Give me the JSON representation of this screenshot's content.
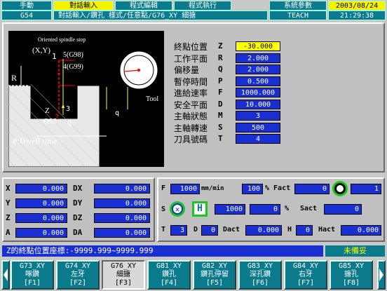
{
  "top_tabs": [
    {
      "label": "手動",
      "selected": false
    },
    {
      "label": "對話輸入",
      "selected": true
    },
    {
      "label": "程式編輯",
      "selected": false
    },
    {
      "label": "程式執行",
      "selected": false
    },
    {
      "label": "系統參數",
      "selected": false
    },
    {
      "label": "2003/08/24",
      "selected": true
    }
  ],
  "info_bar": {
    "gcode": "G54",
    "breadcrumb": "對話輸入/鑽孔 樣式/任意點/G76_XY 細搪",
    "mode": "TEACH",
    "time": "21:29:38"
  },
  "diagram": {
    "labels": [
      "Oriented spindle stop",
      "(X,Y)",
      "1",
      "5(G98)",
      "4(G99)",
      "R",
      "Z",
      "3",
      "2",
      "OSS",
      "q",
      "P:Dwell time",
      "Tool",
      "q"
    ]
  },
  "params": [
    {
      "label": "終點位置",
      "letter": "Z",
      "value": "-30.000",
      "active": true
    },
    {
      "label": "工作平面",
      "letter": "R",
      "value": "2.000",
      "active": false
    },
    {
      "label": "偏移量",
      "letter": "Q",
      "value": "2.000",
      "active": false
    },
    {
      "label": "暫停時間",
      "letter": "P",
      "value": "0.500",
      "active": false
    },
    {
      "label": "進給速率",
      "letter": "F",
      "value": "1000.000",
      "active": false
    },
    {
      "label": "安全平面",
      "letter": "D",
      "value": "10.000",
      "active": false
    },
    {
      "label": "主軸狀態",
      "letter": "M",
      "value": "3",
      "active": false
    },
    {
      "label": "主軸轉速",
      "letter": "S",
      "value": "500",
      "active": false
    },
    {
      "label": "刀具號碼",
      "letter": "T",
      "value": "4",
      "active": false
    }
  ],
  "axes": [
    {
      "a": "X",
      "av": "0.000",
      "b": "DX",
      "bv": "0.000"
    },
    {
      "a": "Y",
      "av": "0.000",
      "b": "DY",
      "bv": "0.000"
    },
    {
      "a": "Z",
      "av": "0.000",
      "b": "DZ",
      "bv": "0.000"
    },
    {
      "a": "A",
      "av": "0.000",
      "b": "DA",
      "bv": "0.000"
    }
  ],
  "feed": {
    "f_letter": "F",
    "f_value": "1000",
    "f_unit": "mm/min",
    "f_pct": "100",
    "fact_label": "% Fact",
    "fact_value": "0",
    "spindle_idx": "1",
    "s_letter": "S",
    "h_label": "H",
    "s_value": "1000",
    "s_pct": "0",
    "s_pct_sign": "%",
    "sact_label": "Sact",
    "sact_value": "0",
    "t_letter": "T",
    "t_value": "3",
    "d_letter": "D",
    "d_value": "0",
    "dact_label": "Dact",
    "dact_value": "0.000",
    "h_letter": "H",
    "h_value": "0",
    "hact_label": "Hact",
    "hact_value": "0.000"
  },
  "status": {
    "message": "Z的終點位置座標:-9999.999~9999.999",
    "state": "未備妥"
  },
  "softkeys": [
    {
      "l1": "G73_XY",
      "l2": "啄鑽",
      "l3": "[F1]",
      "selected": false
    },
    {
      "l1": "G74_XY",
      "l2": "左牙",
      "l3": "[F2]",
      "selected": false
    },
    {
      "l1": "G76_XY",
      "l2": "細搪",
      "l3": "[F3]",
      "selected": true
    },
    {
      "l1": "G81_XY",
      "l2": "鑽孔",
      "l3": "[F4]",
      "selected": false
    },
    {
      "l1": "G82_XY",
      "l2": "鑽孔停留",
      "l3": "[F5]",
      "selected": false
    },
    {
      "l1": "G83_XY",
      "l2": "深孔鑽",
      "l3": "[F6]",
      "selected": false
    },
    {
      "l1": "G84_XY",
      "l2": "右牙",
      "l3": "[F7]",
      "selected": false
    },
    {
      "l1": "G85_XY",
      "l2": "搪孔",
      "l3": "[F8]",
      "selected": false
    }
  ],
  "colors": {
    "teal": "#0a7a8c",
    "blue": "#1a2fd2",
    "yellow": "#ffff00",
    "green": "#19c81e"
  }
}
